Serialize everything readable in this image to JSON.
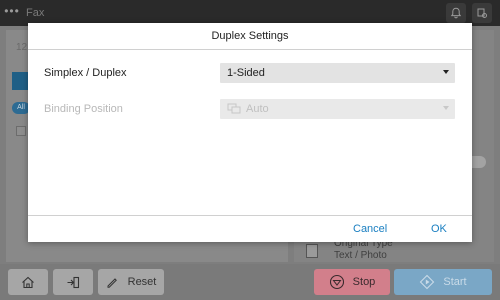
{
  "app": {
    "title": "Fax",
    "menu_icon": "ellipsis-icon",
    "counter": "12"
  },
  "topbar_icons": [
    "bell-icon",
    "status-icon"
  ],
  "background": {
    "all_chip": "All",
    "original_type_title": "Original Type",
    "original_type_value": "Text / Photo"
  },
  "dialog": {
    "title": "Duplex Settings",
    "simplex_duplex": {
      "label": "Simplex / Duplex",
      "value": "1-Sided"
    },
    "binding_position": {
      "label": "Binding Position",
      "value": "Auto",
      "disabled": true
    },
    "cancel_label": "Cancel",
    "ok_label": "OK",
    "accent_color": "#1a7fc1"
  },
  "bottom_bar": {
    "reset_label": "Reset",
    "stop_label": "Stop",
    "start_label": "Start",
    "stop_color": "#d27f8b",
    "start_color": "#7aa7c6"
  }
}
